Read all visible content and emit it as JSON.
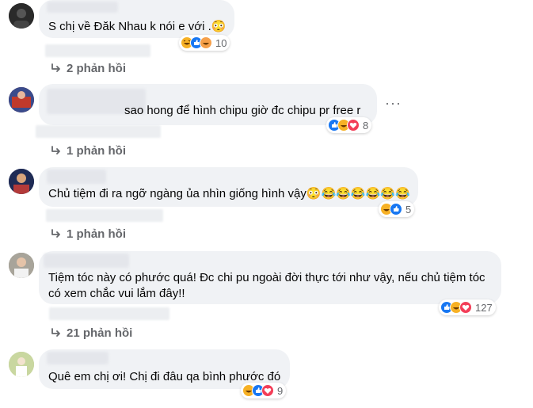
{
  "comments": [
    {
      "text": "S chị về Đăk Nhau k nói e với .😳",
      "reaction_count": "10",
      "replies_label": "2 phản hồi",
      "reactions": [
        "haha",
        "like",
        "haha"
      ]
    },
    {
      "text": "sao hong để hình chipu giờ đc chipu pr free r",
      "reaction_count": "8",
      "replies_label": "1 phản hồi",
      "more_label": "···",
      "reactions": [
        "like",
        "haha",
        "love"
      ]
    },
    {
      "text": "Chủ tiệm đi ra ngỡ ngàng ủa nhìn giống hình vậy😳😂😂😂😂😂😂",
      "reaction_count": "5",
      "replies_label": "1 phản hồi",
      "reactions": [
        "haha",
        "like"
      ]
    },
    {
      "text": "Tiệm tóc này có phước quá! Đc chi pu ngoài đời thực tới như vậy, nếu chủ tiệm tóc có xem chắc vui lắm đây!!",
      "reaction_count": "127",
      "replies_label": "21 phản hồi",
      "reactions": [
        "like",
        "haha",
        "love"
      ]
    },
    {
      "text": "Quê em chị ơi! Chị đi đâu qa bình phước đó",
      "reaction_count": "9",
      "reactions": [
        "haha",
        "like",
        "love"
      ]
    }
  ],
  "colors": {
    "bubble": "#f0f2f5",
    "secondary_text": "#65676b",
    "like": "#1877f2",
    "haha": "#f7b125",
    "love": "#f33e58"
  }
}
